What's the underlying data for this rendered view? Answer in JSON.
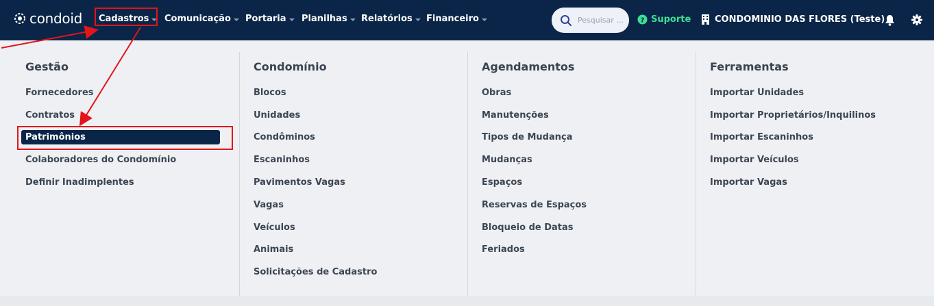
{
  "brand": {
    "name": "condoid"
  },
  "nav": [
    {
      "label": "Cadastros"
    },
    {
      "label": "Comunicação"
    },
    {
      "label": "Portaria"
    },
    {
      "label": "Planilhas"
    },
    {
      "label": "Relatórios"
    },
    {
      "label": "Financeiro"
    }
  ],
  "search": {
    "placeholder": "Pesquisar ..."
  },
  "support": {
    "label": "Suporte"
  },
  "condominium": {
    "label": "CONDOMINIO DAS FLORES (Teste)"
  },
  "colors": {
    "topbar": "#0a2547",
    "support": "#3ddf95",
    "highlight": "#e3141b"
  },
  "columns": [
    {
      "title": "Gestão",
      "items": [
        "Fornecedores",
        "Contratos",
        "Patrimônios",
        "Colaboradores do Condomínio",
        "Definir Inadimplentes"
      ]
    },
    {
      "title": "Condomínio",
      "items": [
        "Blocos",
        "Unidades",
        "Condôminos",
        "Escaninhos",
        "Pavimentos Vagas",
        "Vagas",
        "Veículos",
        "Animais",
        "Solicitações de Cadastro"
      ]
    },
    {
      "title": "Agendamentos",
      "items": [
        "Obras",
        "Manutenções",
        "Tipos de Mudança",
        "Mudanças",
        "Espaços",
        "Reservas de Espaços",
        "Bloqueio de Datas",
        "Feriados"
      ]
    },
    {
      "title": "Ferramentas",
      "items": [
        "Importar Unidades",
        "Importar Proprietários/Inquilinos",
        "Importar Escaninhos",
        "Importar Veículos",
        "Importar Vagas"
      ]
    }
  ],
  "active_item": "Patrimônios"
}
